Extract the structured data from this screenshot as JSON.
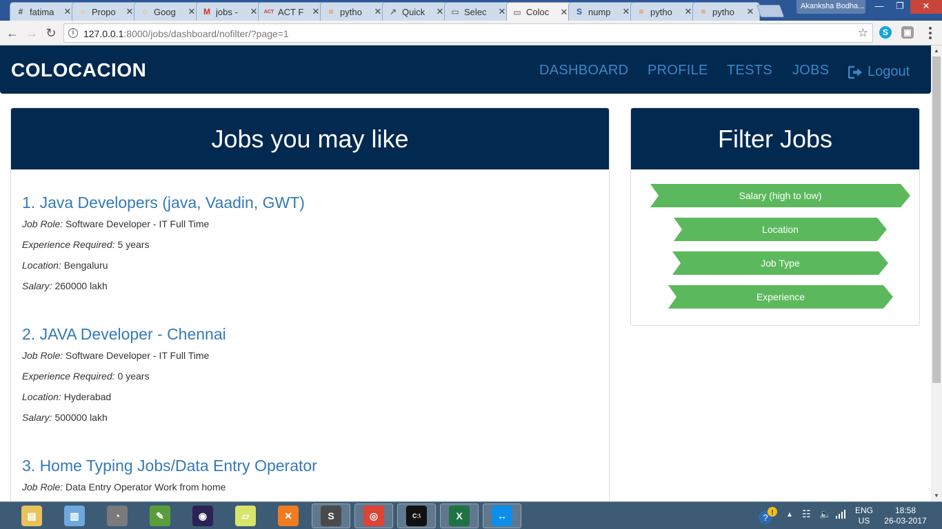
{
  "browser": {
    "tabs": [
      {
        "label": "fatima",
        "icon": "#",
        "icon_color": "#4a4a4a"
      },
      {
        "label": "Propo",
        "icon": "○",
        "icon_color": "#f0b400"
      },
      {
        "label": "Goog",
        "icon": "○",
        "icon_color": "#f0b400"
      },
      {
        "label": "jobs -",
        "icon": "M",
        "icon_color": "#d93025"
      },
      {
        "label": "ACT F",
        "icon": "ACT",
        "icon_color": "#d32f2f"
      },
      {
        "label": "pytho",
        "icon": "≡",
        "icon_color": "#f48024"
      },
      {
        "label": "Quick",
        "icon": "↗",
        "icon_color": "#6a6a6a"
      },
      {
        "label": "Selec",
        "icon": "▭",
        "icon_color": "#888888"
      },
      {
        "label": "Coloc",
        "icon": "▭",
        "icon_color": "#888888",
        "active": true
      },
      {
        "label": "nump",
        "icon": "S",
        "icon_color": "#2a5ca8"
      },
      {
        "label": "pytho",
        "icon": "≡",
        "icon_color": "#f48024"
      },
      {
        "label": "pytho",
        "icon": "≡",
        "icon_color": "#f48024"
      }
    ],
    "profile_name": "Akanksha Bodha...",
    "url_host": "127.0.0.1",
    "url_path": ":8000/jobs/dashboard/nofilter/?page=1"
  },
  "site": {
    "brand": "COLOCACION",
    "nav": {
      "dashboard": "DASHBOARD",
      "profile": "PROFILE",
      "tests": "TESTS",
      "jobs": "JOBS",
      "logout": "Logout"
    },
    "link_color": "#337ab7",
    "header_bg": "#02294f",
    "filter_color": "#5cb85c"
  },
  "jobs_panel": {
    "title": "Jobs you may like",
    "labels": {
      "role": "Job Role:",
      "experience": "Experience Required:",
      "location": "Location:",
      "salary": "Salary:"
    },
    "jobs": [
      {
        "title": "1. Java Developers (java, Vaadin, GWT)",
        "role": "Software Developer - IT Full Time",
        "experience": "5 years",
        "location": "Bengaluru",
        "salary": "260000 lakh"
      },
      {
        "title": "2. JAVA Developer - Chennai",
        "role": "Software Developer - IT Full Time",
        "experience": "0 years",
        "location": "Hyderabad",
        "salary": "500000 lakh"
      },
      {
        "title": "3. Home Typing Jobs/Data Entry Operator",
        "role": "Data Entry Operator Work from home"
      }
    ]
  },
  "filter_panel": {
    "title": "Filter Jobs",
    "buttons": {
      "salary": "Salary (high to low)",
      "location": "Location",
      "job_type": "Job Type",
      "experience": "Experience"
    }
  },
  "taskbar": {
    "apps": [
      {
        "name": "file-explorer",
        "glyph": "▤",
        "color": "#e8c25a"
      },
      {
        "name": "notepad",
        "glyph": "▥",
        "color": "#6fa8dc"
      },
      {
        "name": "app-circle",
        "glyph": "◔",
        "color": "#7a7a7a"
      },
      {
        "name": "editor",
        "glyph": "✎",
        "color": "#5a9e3c"
      },
      {
        "name": "eclipse",
        "glyph": "◉",
        "color": "#2c2255"
      },
      {
        "name": "sticky-notes",
        "glyph": "▱",
        "color": "#d8e46a"
      },
      {
        "name": "xampp",
        "glyph": "✕",
        "color": "#f07c1f"
      },
      {
        "name": "sublime-text",
        "glyph": "S",
        "color": "#4a4a4a"
      },
      {
        "name": "chrome",
        "glyph": "◎",
        "color": "#db4437"
      },
      {
        "name": "command-prompt",
        "glyph": "C:\\",
        "color": "#111111"
      },
      {
        "name": "excel",
        "glyph": "X",
        "color": "#1f7244"
      },
      {
        "name": "teamviewer",
        "glyph": "↔",
        "color": "#0e8ee9"
      }
    ],
    "lang_line1": "ENG",
    "lang_line2": "US",
    "time": "18:58",
    "date": "26-03-2017"
  }
}
